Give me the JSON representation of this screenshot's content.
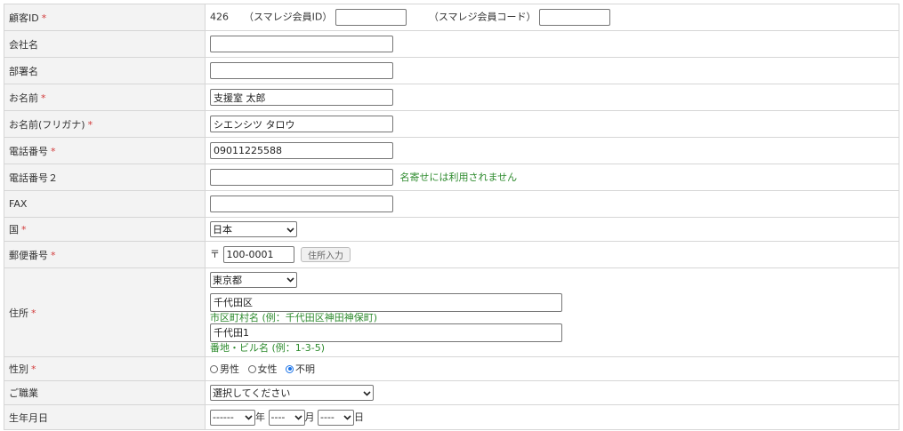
{
  "required_mark": "*",
  "customer_id": {
    "label": "顧客ID",
    "value": "426",
    "smaregi_id_label": "（スマレジ会員ID）",
    "smaregi_id_value": "",
    "smaregi_code_label": "（スマレジ会員コード）",
    "smaregi_code_value": ""
  },
  "company": {
    "label": "会社名",
    "value": ""
  },
  "department": {
    "label": "部署名",
    "value": ""
  },
  "name": {
    "label": "お名前",
    "value": "支援室 太郎"
  },
  "name_kana": {
    "label": "お名前(フリガナ)",
    "value": "シエンシツ タロウ"
  },
  "phone": {
    "label": "電話番号",
    "value": "09011225588"
  },
  "phone2": {
    "label": "電話番号２",
    "value": "",
    "hint": "名寄せには利用されません"
  },
  "fax": {
    "label": "FAX",
    "value": ""
  },
  "country": {
    "label": "国",
    "selected": "日本"
  },
  "postal": {
    "label": "郵便番号",
    "prefix": "〒",
    "value": "100-0001",
    "button": "住所入力"
  },
  "address": {
    "label": "住所",
    "prefecture": "東京都",
    "city": "千代田区",
    "city_hint": "市区町村名 (例：千代田区神田神保町)",
    "street": "千代田1",
    "street_hint": "番地・ビル名 (例：1-3-5)"
  },
  "gender": {
    "label": "性別",
    "options": [
      "男性",
      "女性",
      "不明"
    ],
    "selected_index": 2
  },
  "occupation": {
    "label": "ご職業",
    "selected": "選択してください"
  },
  "birthday": {
    "label": "生年月日",
    "year": "------",
    "year_unit": "年",
    "month": "----",
    "month_unit": "月",
    "day": "----",
    "day_unit": "日"
  },
  "colors": {
    "required": "#d23a3a",
    "hint": "#2e8b2e",
    "label_bg": "#f3f3f3",
    "radio_selected": "#1a73e8"
  }
}
